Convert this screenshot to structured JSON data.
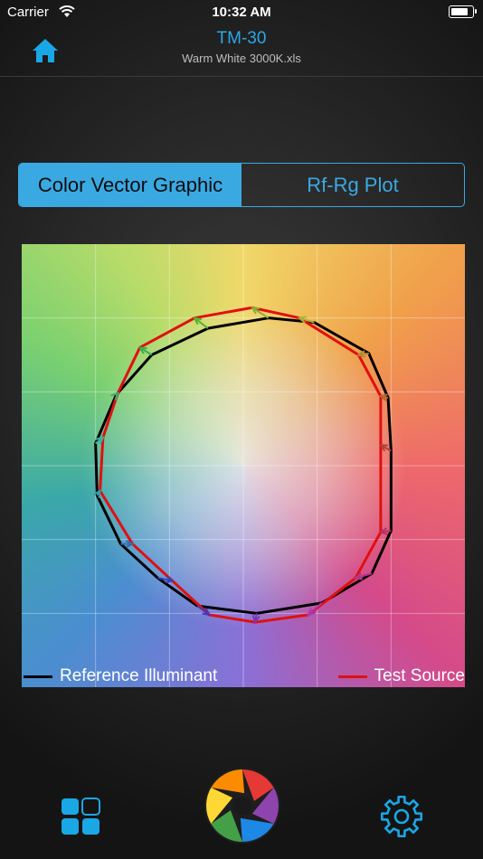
{
  "status_bar": {
    "carrier": "Carrier",
    "time": "10:32 AM",
    "battery_fraction": 0.9
  },
  "nav": {
    "title": "TM-30",
    "subtitle": "Warm White 3000K.xls"
  },
  "segments": [
    {
      "label": "Color Vector Graphic",
      "selected": true
    },
    {
      "label": "Rf-Rg Plot",
      "selected": false
    }
  ],
  "chart_data": {
    "type": "line",
    "series": [
      {
        "name": "Reference Illuminant",
        "color": "#000000",
        "x": [
          1.0,
          0.98,
          0.85,
          0.48,
          0.17,
          -0.24,
          -0.62,
          -0.86,
          -1.0,
          -0.99,
          -0.83,
          -0.58,
          -0.31,
          0.09,
          0.53,
          0.87,
          1.0
        ],
        "y": [
          0.1,
          0.46,
          0.76,
          0.97,
          1.0,
          0.93,
          0.75,
          0.48,
          0.15,
          -0.2,
          -0.53,
          -0.76,
          -0.95,
          -1.0,
          -0.93,
          -0.73,
          -0.44
        ]
      },
      {
        "name": "Test Source",
        "color": "#e01010",
        "x": [
          0.93,
          0.93,
          0.78,
          0.38,
          0.06,
          -0.33,
          -0.7,
          -0.85,
          -0.95,
          -0.97,
          -0.75,
          -0.48,
          -0.23,
          0.08,
          0.44,
          0.76,
          0.93
        ],
        "y": [
          0.14,
          0.47,
          0.75,
          1.0,
          1.07,
          1.0,
          0.8,
          0.49,
          0.19,
          -0.17,
          -0.53,
          -0.78,
          -1.01,
          -1.06,
          -1.01,
          -0.76,
          -0.45
        ]
      }
    ],
    "arrows": "reference to test, one per hue bin",
    "xlim": [
      -1.5,
      1.5
    ],
    "ylim": [
      -1.5,
      1.5
    ],
    "grid": true
  },
  "toolbar": {
    "left_icon": "grid-icon",
    "center_icon": "aperture-logo-icon",
    "right_icon": "gear-icon",
    "accent_color": "#1aa7e6"
  }
}
